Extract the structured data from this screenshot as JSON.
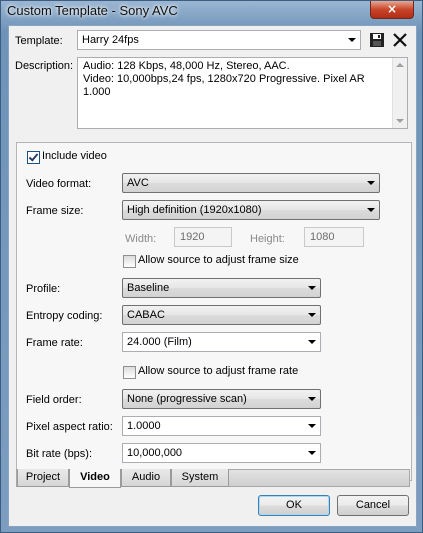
{
  "window": {
    "title": "Custom Template - Sony AVC",
    "close_glyph": "×"
  },
  "template": {
    "label": "Template:",
    "value": "Harry 24fps"
  },
  "description": {
    "label": "Description:",
    "text": "Audio: 128 Kbps, 48,000 Hz, Stereo, AAC.\nVideo: 10,000bps,24 fps, 1280x720 Progressive. Pixel AR\n1.000"
  },
  "video": {
    "include_video_label": "Include video",
    "include_video_checked": true,
    "video_format_label": "Video format:",
    "video_format_value": "AVC",
    "frame_size_label": "Frame size:",
    "frame_size_value": "High definition (1920x1080)",
    "width_label": "Width:",
    "width_value": "1920",
    "height_label": "Height:",
    "height_value": "1080",
    "allow_frame_size_label": "Allow source to adjust frame size",
    "profile_label": "Profile:",
    "profile_value": "Baseline",
    "entropy_label": "Entropy coding:",
    "entropy_value": "CABAC",
    "frame_rate_label": "Frame rate:",
    "frame_rate_value": "24.000 (Film)",
    "allow_frame_rate_label": "Allow source to adjust frame rate",
    "field_order_label": "Field order:",
    "field_order_value": "None (progressive scan)",
    "pixel_aspect_label": "Pixel aspect ratio:",
    "pixel_aspect_value": "1.0000",
    "bit_rate_label": "Bit rate (bps):",
    "bit_rate_value": "10,000,000"
  },
  "tabs": [
    {
      "label": "Project"
    },
    {
      "label": "Video"
    },
    {
      "label": "Audio"
    },
    {
      "label": "System"
    }
  ],
  "buttons": {
    "ok": "OK",
    "cancel": "Cancel"
  },
  "icons": {
    "save": "save-icon",
    "delete": "delete-icon"
  }
}
